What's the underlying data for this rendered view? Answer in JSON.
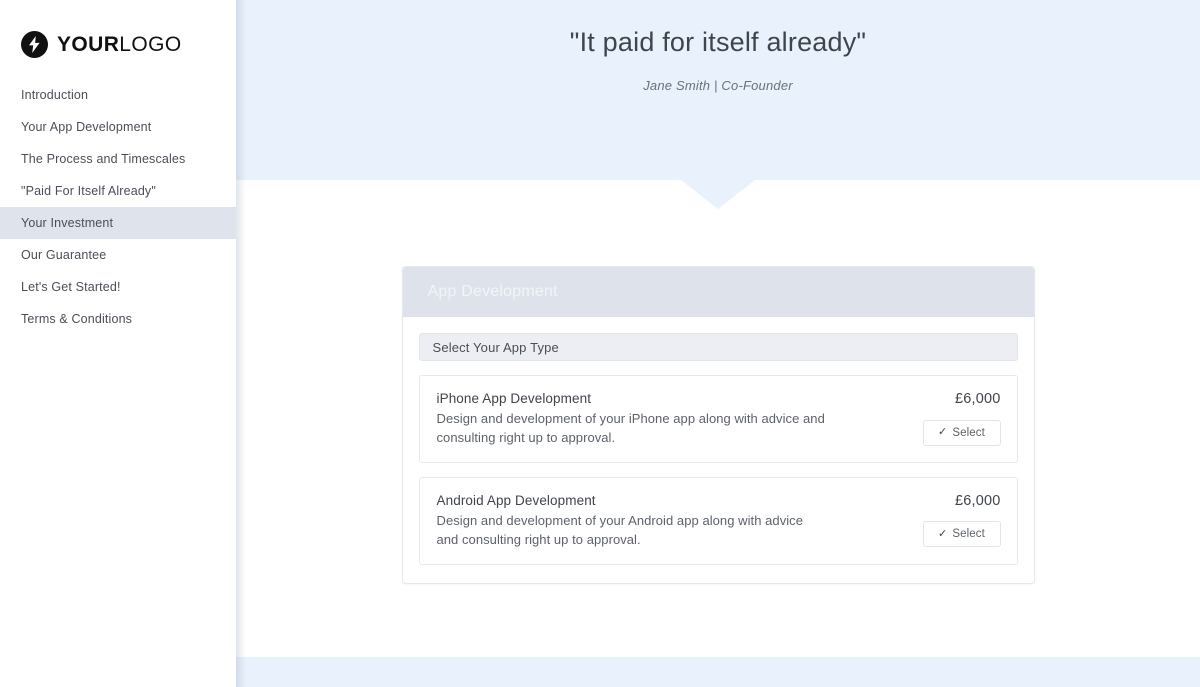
{
  "brand": {
    "logo_icon": "lightning-bolt-icon",
    "name_bold": "YOUR",
    "name_light": "LOGO"
  },
  "sidebar": {
    "items": [
      {
        "label": "Introduction",
        "active": false
      },
      {
        "label": "Your App Development",
        "active": false
      },
      {
        "label": "The Process and Timescales",
        "active": false
      },
      {
        "label": "\"Paid For Itself Already\"",
        "active": false
      },
      {
        "label": "Your Investment",
        "active": true
      },
      {
        "label": "Our Guarantee",
        "active": false
      },
      {
        "label": "Let's Get Started!",
        "active": false
      },
      {
        "label": "Terms & Conditions",
        "active": false
      }
    ]
  },
  "hero": {
    "quote": "\"It paid for itself already\"",
    "author": "Jane Smith | Co-Founder",
    "background_color": "#e9f1fc"
  },
  "card": {
    "header_title": "App Development",
    "header_background": "#dee2ea",
    "section_label": "Select Your App Type",
    "items": [
      {
        "title": "iPhone App Development",
        "description": "Design and development of your iPhone app along with advice and consulting right up to approval.",
        "price": "£6,000",
        "button_label": "Select",
        "button_icon": "check-icon"
      },
      {
        "title": "Android App Development",
        "description": "Design and development of your Android app along with advice and consulting right up to approval.",
        "price": "£6,000",
        "button_label": "Select",
        "button_icon": "check-icon"
      }
    ]
  }
}
